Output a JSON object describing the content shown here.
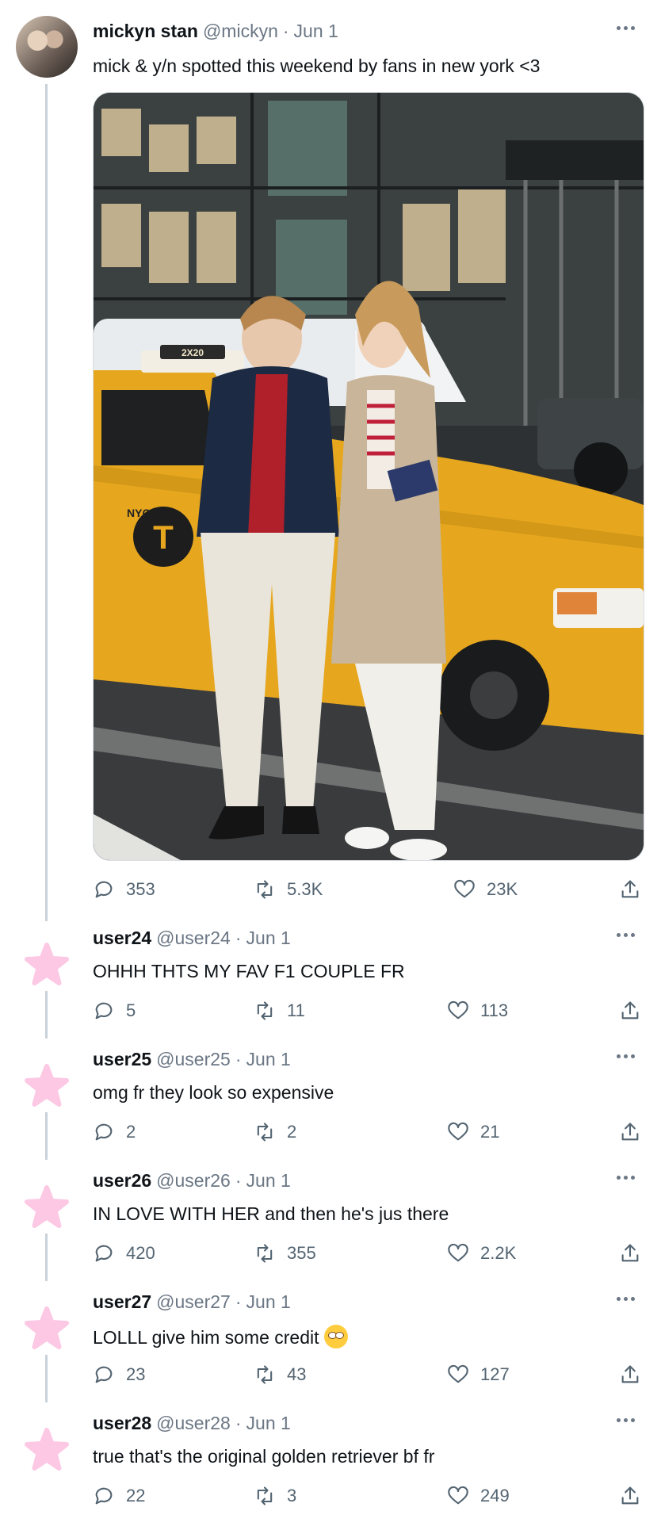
{
  "main_tweet": {
    "name": "mickyn stan",
    "handle": "@mickyn",
    "date": "Jun 1",
    "separator": "·",
    "text": "mick & y/n spotted this weekend by fans in new york <3",
    "photo": {
      "taxi_roof_sign": "2X20",
      "taxi_door_text": "NYC",
      "taxi_logo": "T"
    },
    "stats": {
      "replies": "353",
      "retweets": "5.3K",
      "likes": "23K"
    }
  },
  "replies": [
    {
      "name": "user24",
      "handle": "@user24",
      "date": "Jun 1",
      "text": "OHHH THTS MY FAV F1 COUPLE FR",
      "replies": "5",
      "retweets": "11",
      "likes": "113"
    },
    {
      "name": "user25",
      "handle": "@user25",
      "date": "Jun 1",
      "text": "omg fr they look so expensive",
      "replies": "2",
      "retweets": "2",
      "likes": "21"
    },
    {
      "name": "user26",
      "handle": "@user26",
      "date": "Jun 1",
      "text": "IN LOVE WITH HER and then he's jus there",
      "replies": "420",
      "retweets": "355",
      "likes": "2.2K"
    },
    {
      "name": "user27",
      "handle": "@user27",
      "date": "Jun 1",
      "text": "LOLLL give him some credit",
      "emoji": "rolling-eyes-emoji",
      "replies": "23",
      "retweets": "43",
      "likes": "127"
    },
    {
      "name": "user28",
      "handle": "@user28",
      "date": "Jun 1",
      "text": "true that's the original golden retriever bf fr",
      "replies": "22",
      "retweets": "3",
      "likes": "249"
    }
  ],
  "colors": {
    "star": "#fcc8e4",
    "muted": "#6b7785",
    "thread_line": "#c9d1da",
    "taxi_yellow": "#e6a71f"
  }
}
